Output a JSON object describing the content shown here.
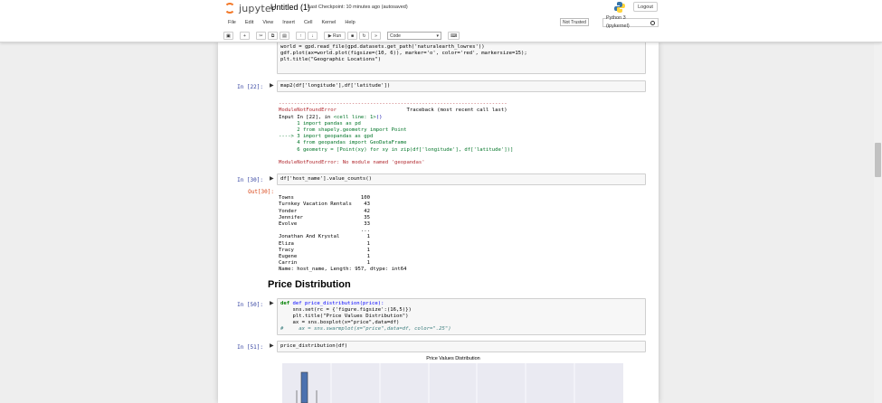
{
  "header": {
    "logo_text": "jupyter",
    "notebook_name": "Untitled (1)",
    "checkpoint": "Last Checkpoint: 10 minutes ago  (autosaved)",
    "logout_label": "Logout",
    "trust_label": "Not Trusted",
    "kernel_label": "Python 3 (ipykernel)"
  },
  "menu": [
    "File",
    "Edit",
    "View",
    "Insert",
    "Cell",
    "Kernel",
    "Help"
  ],
  "toolbar": {
    "run_label": "Run",
    "cell_type": "Code",
    "icons": [
      "save-icon",
      "plus-icon",
      "cut-icon",
      "copy-icon",
      "paste-icon",
      "arrow-up-icon",
      "arrow-down-icon",
      "run-icon",
      "stop-icon",
      "restart-icon",
      "fast-forward-icon",
      "keyboard-icon"
    ]
  },
  "cells": {
    "top": {
      "lines": [
        "#this is a simple map that goes with geopandas",
        "world = gpd.read_file(gpd.datasets.get_path('naturalearth_lowres'))",
        "gdf.plot(ax=world.plot(figsize=(10, 6)), marker='o', color='red', markersize=15);",
        "plt.title(\"Geographic Locations\")"
      ]
    },
    "c22": {
      "prompt": "In [22]:",
      "code": "map2(df['longitude'],df['latitude'])",
      "error": {
        "rule": "---------------------------------------------------------------------------",
        "name": "ModuleNotFoundError",
        "traceback_label": "Traceback (most recent call last)",
        "input_line": "Input In [22], in ",
        "cell_line": "<cell line: 1>",
        "cell_paren": "()",
        "lines": [
          "      1 import pandas as pd",
          "      2 from shapely.geometry import Point",
          "----> 3 import geopandas as gpd",
          "      4 from geopandas import GeoDataFrame",
          "      6 geometry = [Point(xy) for xy in zip(df['longitude'], df['latitude'])]"
        ],
        "message": "ModuleNotFoundError: No module named 'geopandas'"
      }
    },
    "c30": {
      "prompt": "In [30]:",
      "out_prompt": "Out[30]:",
      "code": "df['host_name'].value_counts()",
      "output": [
        "Towns                      100",
        "Turnkey Vacation Rentals    43",
        "Yonder                      42",
        "Jennifer                    35",
        "Evolve                      33",
        "                           ...",
        "Jonathan And Krystal         1",
        "Eliza                        1",
        "Tracy                        1",
        "Eugene                       1",
        "Carrin                       1",
        "Name: host_name, Length: 957, dtype: int64"
      ]
    },
    "heading": "Price Distribution",
    "c50": {
      "prompt": "In [50]:",
      "lines": [
        "def price_distribution(price):",
        "    sns.set(rc = {'figure.figsize':(16,5)})",
        "    plt.title(\"Price Values Distribution\")",
        "    ax = sns.boxplot(x=\"price\",data=df)",
        "#     ax = sns.swarmplot(x=\"price\",data=df, color=\".25\")"
      ]
    },
    "c51": {
      "prompt": "In [51]:",
      "code": "price_distribution(df)"
    }
  },
  "chart_data": {
    "type": "box",
    "title": "Price Values Distribution",
    "xlabel": "",
    "ylabel": "",
    "grid": true,
    "background": "#eaeaf2",
    "box_color": "#4c72b0"
  }
}
